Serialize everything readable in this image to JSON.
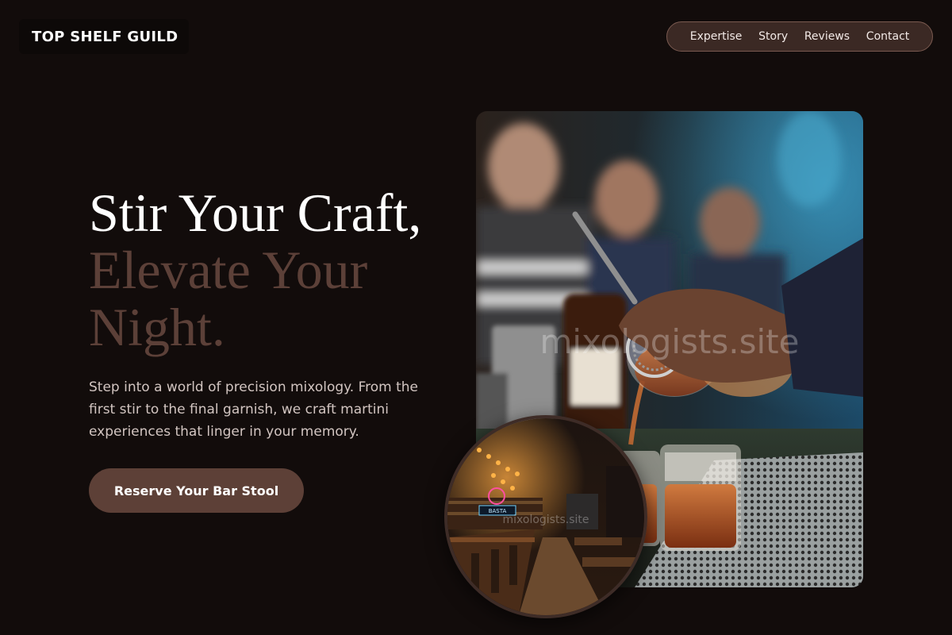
{
  "brand": {
    "name": "TOP SHELF GUILD"
  },
  "nav": {
    "links": [
      "Expertise",
      "Story",
      "Reviews",
      "Contact"
    ]
  },
  "hero": {
    "headline_line1": "Stir Your Craft,",
    "headline_line2": "Elevate Your Night.",
    "intro": "Step into a world of precision mixology. From the first stir to the final garnish, we craft martini experiences that linger in your memory.",
    "cta_label": "Reserve Your Bar Stool"
  },
  "images": {
    "main_watermark": "mixologists.site",
    "inset_watermark": "mixologists.site",
    "inset_sign_text": "BASTA"
  },
  "colors": {
    "background": "#120c0b",
    "accent": "#5d4037",
    "headline_muted": "#5c4038",
    "body_text": "#d2c5c1",
    "nav_pill": "#3b2924"
  }
}
